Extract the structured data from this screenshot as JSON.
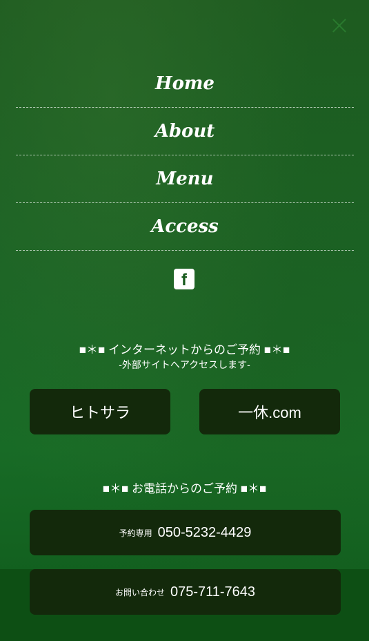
{
  "nav": {
    "items": [
      {
        "label": "Home"
      },
      {
        "label": "About"
      },
      {
        "label": "Menu"
      },
      {
        "label": "Access"
      }
    ]
  },
  "social": {
    "facebook_glyph": "f",
    "icon": "facebook-icon"
  },
  "internet_reservation": {
    "title": "■＊■ インターネットからのご予約 ■＊■",
    "subtitle": "-外部サイトへアクセスします-",
    "buttons": [
      {
        "label": "ヒトサラ"
      },
      {
        "label": "一休.com"
      }
    ]
  },
  "phone_reservation": {
    "title": "■＊■ お電話からのご予約 ■＊■",
    "buttons": [
      {
        "label": "予約専用",
        "number": "050-5232-4429"
      },
      {
        "label": "お問い合わせ",
        "number": "075-711-7643"
      }
    ]
  },
  "colors": {
    "background": "#175a1d",
    "button": "#13290b",
    "text": "#ffffff"
  }
}
